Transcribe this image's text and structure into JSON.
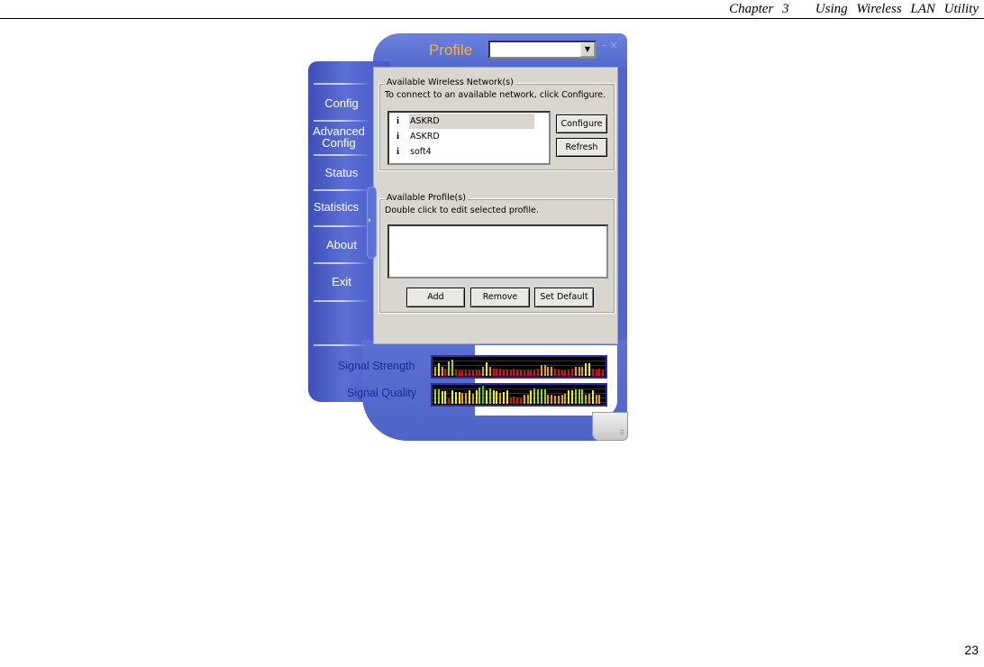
{
  "page_header": "Chapter 3   Using Wireless LAN Utility",
  "page_number": "23",
  "app": {
    "title": "Profile",
    "profile_dropdown_value": "",
    "window_buttons": {
      "minimize": "–",
      "close": "×"
    },
    "nav": [
      "Config",
      "Advanced Config",
      "Status",
      "Statistics",
      "About",
      "Exit"
    ],
    "handle_glyph": "›",
    "networks_group": {
      "legend": "Available Wireless Network(s)",
      "hint": "To connect to an available network, click Configure.",
      "networks": [
        {
          "name": "ASKRD",
          "icon": "signal-tower-icon",
          "selected": true
        },
        {
          "name": "ASKRD",
          "icon": "signal-tower-icon",
          "selected": false
        },
        {
          "name": "soft4",
          "icon": "signal-tower-icon",
          "selected": false
        }
      ],
      "network_icon_glyph": "i",
      "configure_label": "Configure",
      "refresh_label": "Refresh"
    },
    "profiles_group": {
      "legend": "Available Profile(s)",
      "hint": "Double click to edit selected profile.",
      "profiles": [],
      "add_label": "Add",
      "remove_label": "Remove",
      "set_default_label": "Set Default"
    },
    "signal": {
      "strength_label": "Signal Strength",
      "quality_label": "Signal Quality",
      "colors": {
        "high": "#f0f020",
        "mid": "#e0a020",
        "low": "#e01010",
        "best": "#20d020",
        "good": "#a0d020"
      },
      "strength_history": [
        0.5,
        0.7,
        0.5,
        0.4,
        0.8,
        0.9,
        0.35,
        0.3,
        0.3,
        0.3,
        0.3,
        0.3,
        0.3,
        0.3,
        0.5,
        0.75,
        0.5,
        0.4,
        0.4,
        0.4,
        0.35,
        0.35,
        0.3,
        0.4,
        0.35,
        0.3,
        0.3,
        0.3,
        0.3,
        0.3,
        0.4,
        0.6,
        0.6,
        0.5,
        0.5,
        0.4,
        0.35,
        0.3,
        0.3,
        0.3,
        0.4,
        0.5,
        0.5,
        0.5,
        0.7,
        0.7,
        0.4,
        0.35,
        0.4,
        0.35,
        0.3
      ],
      "quality_history": [
        0.8,
        0.8,
        0.7,
        0.7,
        0.3,
        0.75,
        0.65,
        0.65,
        0.6,
        0.6,
        0.75,
        0.55,
        0.75,
        0.9,
        1.0,
        0.75,
        0.85,
        0.75,
        0.7,
        0.6,
        0.65,
        0.75,
        0.35,
        0.4,
        0.35,
        0.3,
        0.5,
        0.5,
        0.75,
        0.85,
        0.8,
        0.8,
        0.8,
        0.5,
        0.5,
        0.45,
        0.45,
        0.5,
        0.55,
        0.75,
        0.75,
        0.8,
        0.8,
        0.8,
        0.5,
        0.55,
        0.75,
        0.5,
        0.5
      ]
    }
  }
}
